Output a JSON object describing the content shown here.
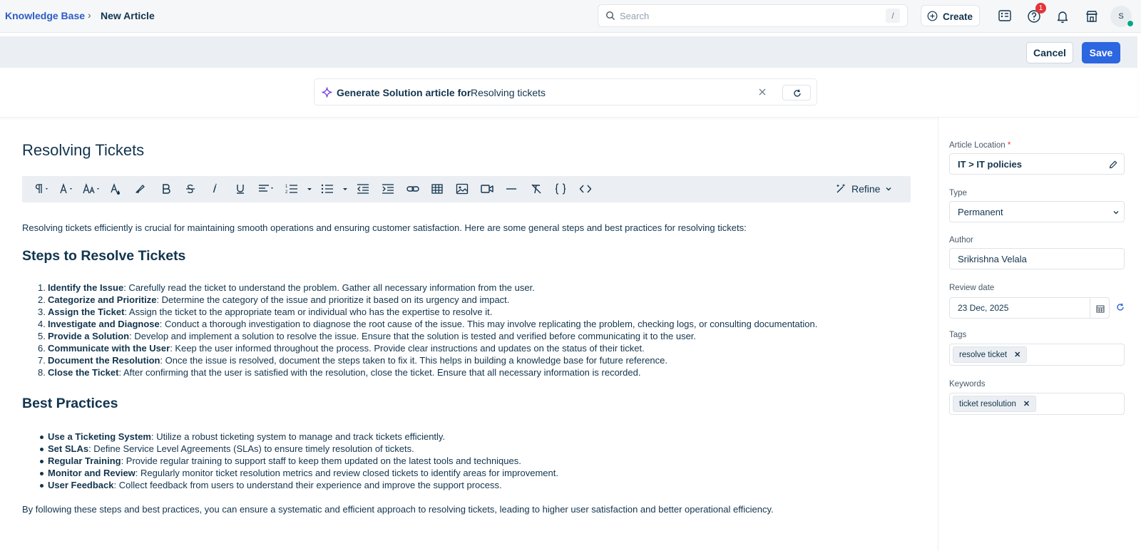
{
  "breadcrumb": {
    "root": "Knowledge Base",
    "separator": "›",
    "current": "New Article"
  },
  "search": {
    "placeholder": "Search",
    "shortcut": "/"
  },
  "header": {
    "create_label": "Create",
    "help_badge": "1",
    "avatar_initial": "S"
  },
  "actions": {
    "cancel_label": "Cancel",
    "save_label": "Save"
  },
  "generate": {
    "label": "Generate Solution article for",
    "value": "Resolving tickets"
  },
  "article": {
    "title": "Resolving Tickets",
    "intro": "Resolving tickets efficiently is crucial for maintaining smooth operations and ensuring customer satisfaction. Here are some general steps and best practices for resolving tickets:",
    "steps_heading": "Steps to Resolve Tickets",
    "steps": [
      {
        "num": "1.",
        "term": "Identify the Issue",
        "text": ": Carefully read the ticket to understand the problem. Gather all necessary information from the user."
      },
      {
        "num": "2.",
        "term": "Categorize and Prioritize",
        "text": ": Determine the category of the issue and prioritize it based on its urgency and impact."
      },
      {
        "num": "3.",
        "term": "Assign the Ticket",
        "text": ": Assign the ticket to the appropriate team or individual who has the expertise to resolve it."
      },
      {
        "num": "4.",
        "term": "Investigate and Diagnose",
        "text": ": Conduct a thorough investigation to diagnose the root cause of the issue. This may involve replicating the problem, checking logs, or consulting documentation."
      },
      {
        "num": "5.",
        "term": "Provide a Solution",
        "text": ": Develop and implement a solution to resolve the issue. Ensure that the solution is tested and verified before communicating it to the user."
      },
      {
        "num": "6.",
        "term": "Communicate with the User",
        "text": ": Keep the user informed throughout the process. Provide clear instructions and updates on the status of their ticket."
      },
      {
        "num": "7.",
        "term": "Document the Resolution",
        "text": ": Once the issue is resolved, document the steps taken to fix it. This helps in building a knowledge base for future reference."
      },
      {
        "num": "8.",
        "term": "Close the Ticket",
        "text": ": After confirming that the user is satisfied with the resolution, close the ticket. Ensure that all necessary information is recorded."
      }
    ],
    "best_heading": "Best Practices",
    "best": [
      {
        "term": "Use a Ticketing System",
        "text": ": Utilize a robust ticketing system to manage and track tickets efficiently."
      },
      {
        "term": "Set SLAs",
        "text": ": Define Service Level Agreements (SLAs) to ensure timely resolution of tickets."
      },
      {
        "term": "Regular Training",
        "text": ": Provide regular training to support staff to keep them updated on the latest tools and techniques."
      },
      {
        "term": "Monitor and Review",
        "text": ": Regularly monitor ticket resolution metrics and review closed tickets to identify areas for improvement."
      },
      {
        "term": "User Feedback",
        "text": ": Collect feedback from users to understand their experience and improve the support process."
      }
    ],
    "outro": "By following these steps and best practices, you can ensure a systematic and efficient approach to resolving tickets, leading to higher user satisfaction and better operational efficiency."
  },
  "toolbar": {
    "refine_label": "Refine"
  },
  "sidebar": {
    "location_label": "Article Location",
    "location_required": "*",
    "location_value": "IT > IT policies",
    "type_label": "Type",
    "type_value": "Permanent",
    "author_label": "Author",
    "author_value": "Srikrishna Velala",
    "review_label": "Review date",
    "review_value": "23 Dec, 2025",
    "tags_label": "Tags",
    "tags": [
      "resolve ticket"
    ],
    "keywords_label": "Keywords",
    "keywords": [
      "ticket resolution"
    ]
  },
  "colors": {
    "brand_blue": "#2c66e0",
    "link_blue": "#2c5cc5",
    "text": "#12344d",
    "badge_red": "#e43538",
    "online_green": "#00a886"
  }
}
